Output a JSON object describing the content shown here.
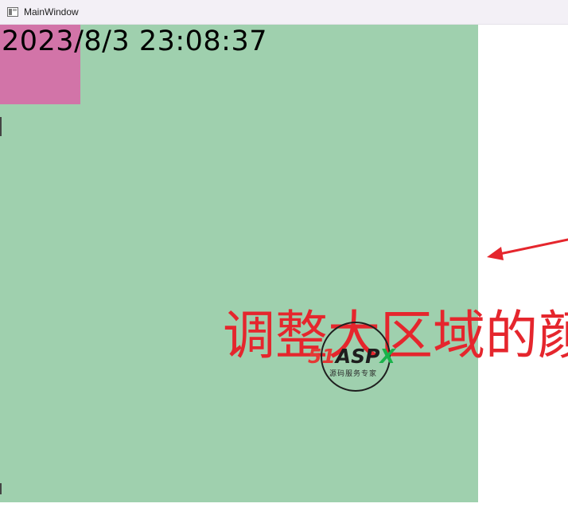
{
  "window": {
    "title": "MainWindow",
    "icon": "app-window-icon"
  },
  "content": {
    "clock_text": "2023/8/3 23:08:37",
    "annotation_text": "调整大区域的颜",
    "colors": {
      "large_area": "#9fd0ae",
      "small_box": "#d274a8",
      "annotation": "#e5262d"
    }
  },
  "watermark": {
    "logo_prefix": "51",
    "logo_main": "ASP",
    "logo_suffix": "X",
    "tagline": "源码服务专家"
  }
}
